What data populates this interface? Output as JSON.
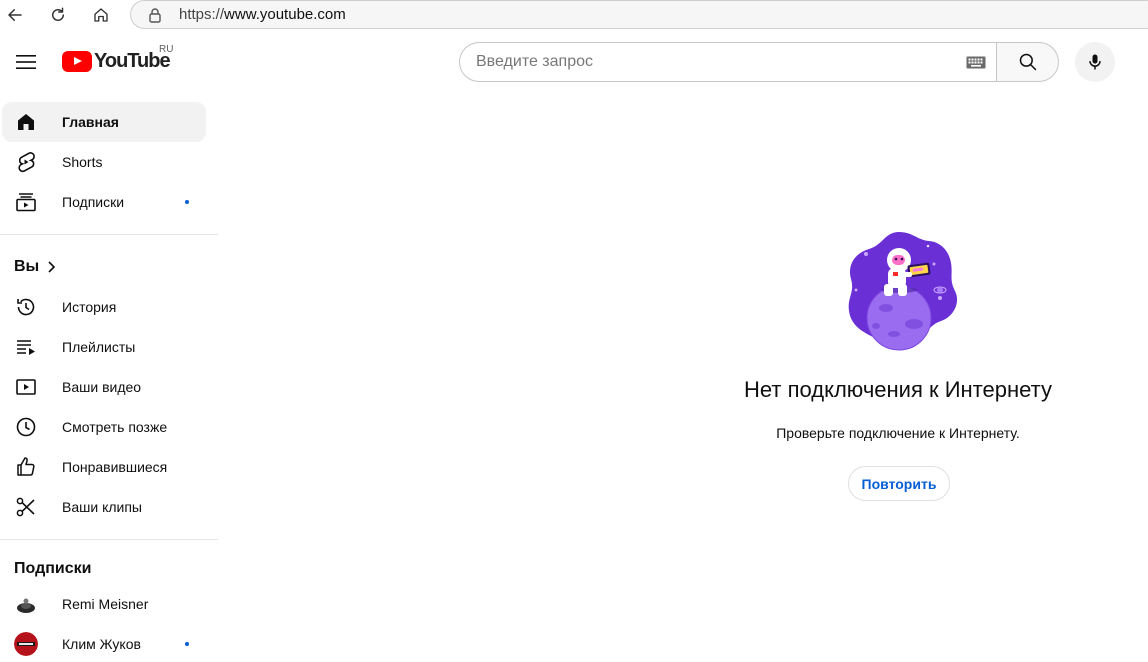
{
  "browser": {
    "url_prefix": "https://",
    "url_host": "www.youtube.com"
  },
  "header": {
    "logo_text": "YouTube",
    "country_code": "RU",
    "search_placeholder": "Введите запрос"
  },
  "sidebar": {
    "main_items": [
      {
        "label": "Главная",
        "icon": "home-icon",
        "active": true
      },
      {
        "label": "Shorts",
        "icon": "shorts-icon"
      },
      {
        "label": "Подписки",
        "icon": "subscriptions-icon",
        "dot": true
      }
    ],
    "you_heading": "Вы",
    "you_items": [
      {
        "label": "История",
        "icon": "history-icon"
      },
      {
        "label": "Плейлисты",
        "icon": "playlists-icon"
      },
      {
        "label": "Ваши видео",
        "icon": "your-videos-icon"
      },
      {
        "label": "Смотреть позже",
        "icon": "watch-later-icon"
      },
      {
        "label": "Понравившиеся",
        "icon": "thumbs-up-icon"
      },
      {
        "label": "Ваши клипы",
        "icon": "clips-icon"
      }
    ],
    "subs_heading": "Подписки",
    "subscriptions": [
      {
        "label": "Remi Meisner"
      },
      {
        "label": "Клим Жуков",
        "dot": true
      }
    ]
  },
  "main": {
    "title": "Нет подключения к Интернету",
    "subtitle": "Проверьте подключение к Интернету.",
    "retry_label": "Повторить"
  },
  "colors": {
    "accent": "#065fd4",
    "logo_red": "#ff0000",
    "illustration_purple": "#6b2fd6"
  }
}
